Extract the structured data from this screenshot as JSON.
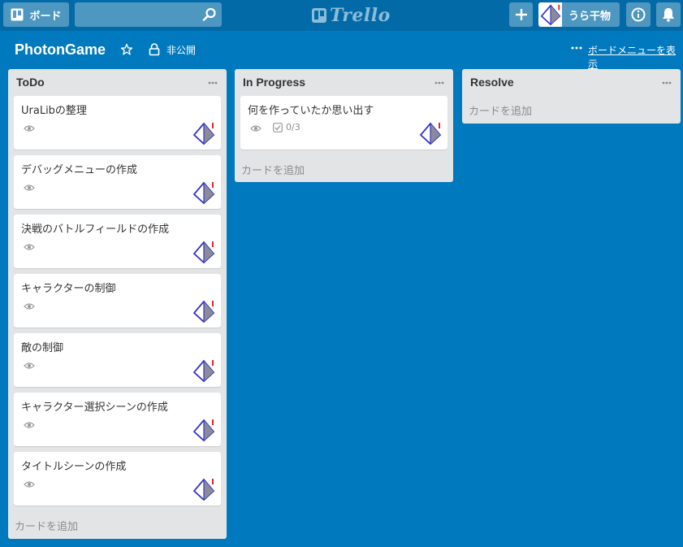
{
  "colors": {
    "board_bg": "#0079bf",
    "header_bg": "#026aa7",
    "list_bg": "#e2e4e6",
    "card_bg": "#ffffff",
    "muted_text": "#8c8c8c"
  },
  "header": {
    "boards_label": "ボード",
    "search": {
      "value": "",
      "placeholder": ""
    },
    "logo_text": "Trello",
    "user_name": "うら干物",
    "icons": [
      "boards-icon",
      "search-icon",
      "trello-logo-icon",
      "plus-icon",
      "avatar-icon",
      "info-icon",
      "bell-icon"
    ]
  },
  "board": {
    "title": "PhotonGame",
    "visibility": "非公開",
    "show_menu_label": "ボードメニューを表示"
  },
  "lists": [
    {
      "title": "ToDo",
      "add_card_label": "カードを追加",
      "cards": [
        {
          "title": "UraLibの整理"
        },
        {
          "title": "デバッグメニューの作成"
        },
        {
          "title": "決戦のバトルフィールドの作成"
        },
        {
          "title": "キャラクターの制御"
        },
        {
          "title": "敵の制御"
        },
        {
          "title": "キャラクター選択シーンの作成"
        },
        {
          "title": "タイトルシーンの作成"
        }
      ]
    },
    {
      "title": "In Progress",
      "add_card_label": "カードを追加",
      "cards": [
        {
          "title": "何を作っていたか思い出す",
          "checklist": "0/3"
        }
      ]
    },
    {
      "title": "Resolve",
      "add_card_label": "カードを追加",
      "cards": []
    }
  ]
}
